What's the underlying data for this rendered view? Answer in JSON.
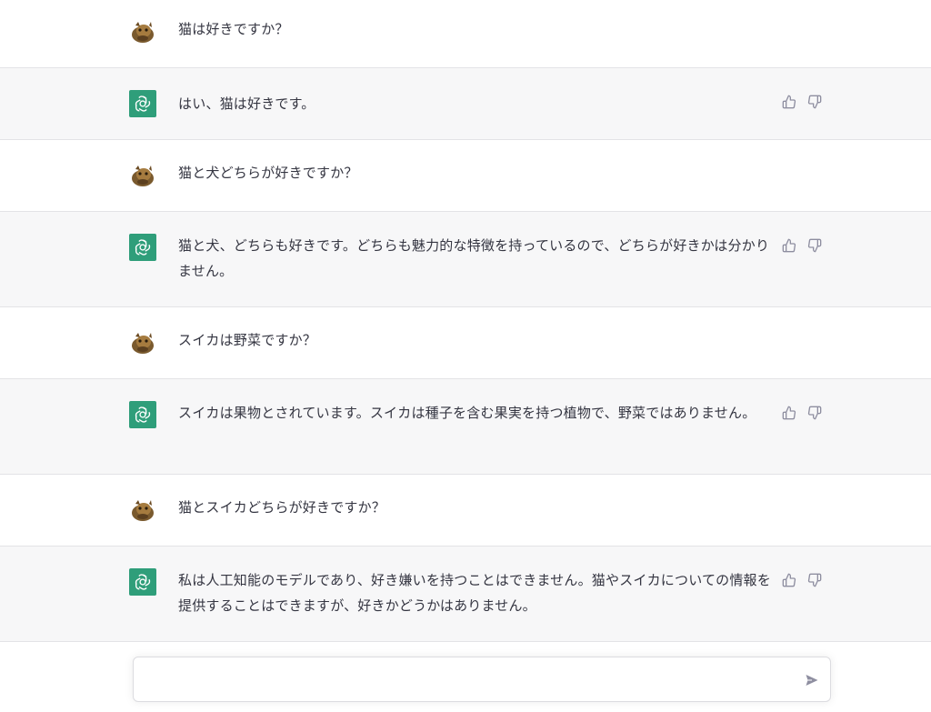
{
  "messages": [
    {
      "role": "user",
      "text": "猫は好きですか？"
    },
    {
      "role": "assistant",
      "text": "はい、猫は好きです。"
    },
    {
      "role": "user",
      "text": "猫と犬どちらが好きですか？"
    },
    {
      "role": "assistant",
      "text": "猫と犬、どちらも好きです。どちらも魅力的な特徴を持っているので、どちらが好きかは分かりません。"
    },
    {
      "role": "user",
      "text": "スイカは野菜ですか？"
    },
    {
      "role": "assistant",
      "text": "スイカは果物とされています。スイカは種子を含む果実を持つ植物で、野菜ではありません。"
    },
    {
      "role": "user",
      "text": "猫とスイカどちらが好きですか？"
    },
    {
      "role": "assistant",
      "text": "私は人工知能のモデルであり、好き嫌いを持つことはできません。猫やスイカについての情報を提供することはできますが、好きかどうかはありません。"
    }
  ],
  "icons": {
    "user_avatar": "user-avatar-icon",
    "assistant_avatar": "openai-logo-icon",
    "thumbs_up": "thumbs-up-icon",
    "thumbs_down": "thumbs-down-icon",
    "send": "send-icon"
  },
  "composer": {
    "value": "",
    "placeholder": ""
  },
  "colors": {
    "assistant_bg": "#f7f7f8",
    "user_bg": "#ffffff",
    "brand": "#2f9e7a",
    "border": "#e3e3e6"
  }
}
